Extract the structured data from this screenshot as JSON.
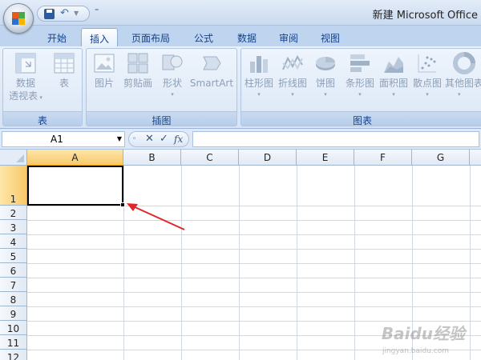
{
  "window": {
    "title": "新建 Microsoft Office"
  },
  "quick_access": {
    "customize_symbol": "⁼"
  },
  "tabs": [
    {
      "label": "开始"
    },
    {
      "label": "插入",
      "active": true
    },
    {
      "label": "页面布局"
    },
    {
      "label": "公式"
    },
    {
      "label": "数据"
    },
    {
      "label": "审阅"
    },
    {
      "label": "视图"
    }
  ],
  "ribbon": {
    "groups": [
      {
        "label": "表",
        "buttons": [
          {
            "label_line1": "数据",
            "label_line2": "透视表",
            "icon": "pivot-table-icon",
            "dropdown": true
          },
          {
            "label_line1": "表",
            "label_line2": "",
            "icon": "table-icon",
            "dropdown": false
          }
        ]
      },
      {
        "label": "插图",
        "buttons": [
          {
            "label_line1": "图片",
            "icon": "picture-icon"
          },
          {
            "label_line1": "剪贴画",
            "icon": "clip-art-icon"
          },
          {
            "label_line1": "形状",
            "icon": "shapes-icon",
            "dropdown": true
          },
          {
            "label_line1": "SmartArt",
            "icon": "smartart-icon"
          }
        ]
      },
      {
        "label": "图表",
        "buttons": [
          {
            "label_line1": "柱形图",
            "icon": "column-chart-icon"
          },
          {
            "label_line1": "折线图",
            "icon": "line-chart-icon"
          },
          {
            "label_line1": "饼图",
            "icon": "pie-chart-icon"
          },
          {
            "label_line1": "条形图",
            "icon": "bar-chart-icon"
          },
          {
            "label_line1": "面积图",
            "icon": "area-chart-icon"
          },
          {
            "label_line1": "散点图",
            "icon": "scatter-chart-icon"
          },
          {
            "label_line1": "其他图表",
            "icon": "other-charts-icon"
          }
        ]
      }
    ]
  },
  "formula_bar": {
    "name_box": "A1",
    "cancel": "✕",
    "enter": "✓",
    "fx": "fx",
    "formula": ""
  },
  "sheet": {
    "columns": [
      "A",
      "B",
      "C",
      "D",
      "E",
      "F",
      "G"
    ],
    "rows": [
      "1",
      "2",
      "3",
      "4",
      "5",
      "6",
      "7",
      "8",
      "9",
      "10",
      "11",
      "12"
    ],
    "active_cell": "A1"
  },
  "watermark": {
    "text": "Baidu经验",
    "sub": "jingyan.baidu.com"
  },
  "colors": {
    "selection_header": "#f9c96a",
    "arrow": "#e0262b",
    "ribbon_bg": "#dbe7f6"
  }
}
